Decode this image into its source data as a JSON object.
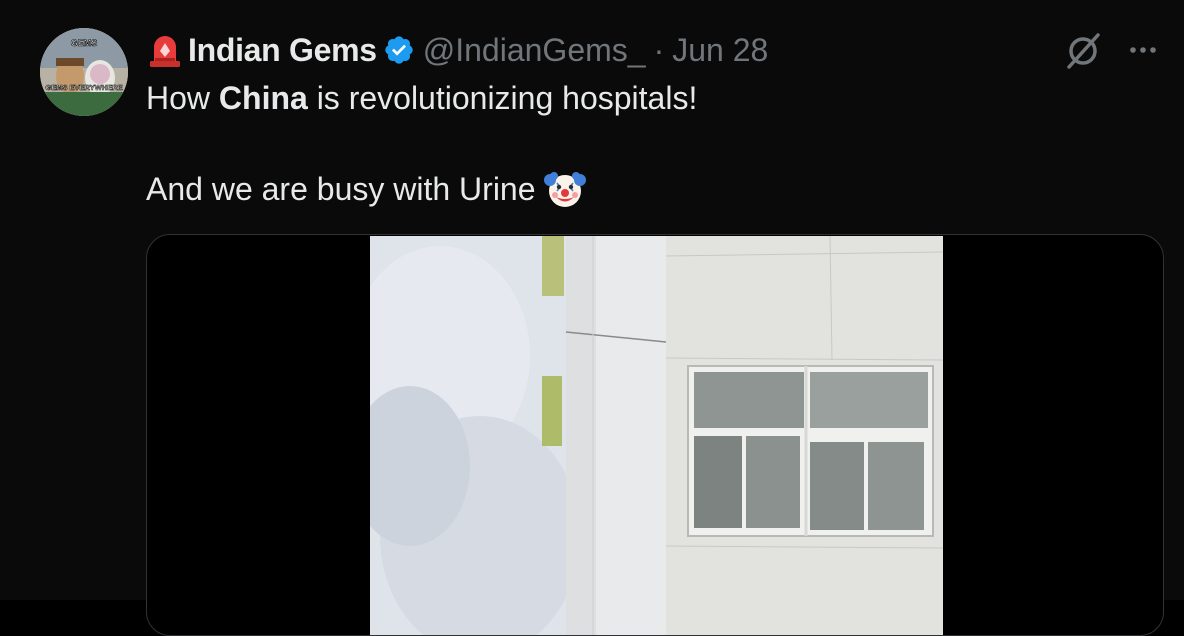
{
  "author": {
    "name": "Indian Gems",
    "handle": "@IndianGems_",
    "separator": "·",
    "date": "Jun 28",
    "avatar_text": {
      "top": "GEMS",
      "bottom": "GEMS EVERYWHERE"
    }
  },
  "tweet": {
    "line1_prefix": "How ",
    "line1_bold": "China",
    "line1_suffix": " is revolutionizing hospitals!",
    "line2": "And we are busy with Urine"
  },
  "icons": {
    "siren": "police-car-light-emoji",
    "verified": "verified-badge-icon",
    "grok": "grok-icon",
    "more": "more-options-icon",
    "clown": "clown-face-emoji"
  },
  "colors": {
    "background": "#0a0a0a",
    "text": "#e7e9ea",
    "muted": "#71767b",
    "verified": "#1d9bf0",
    "media_border": "#2f3336"
  }
}
